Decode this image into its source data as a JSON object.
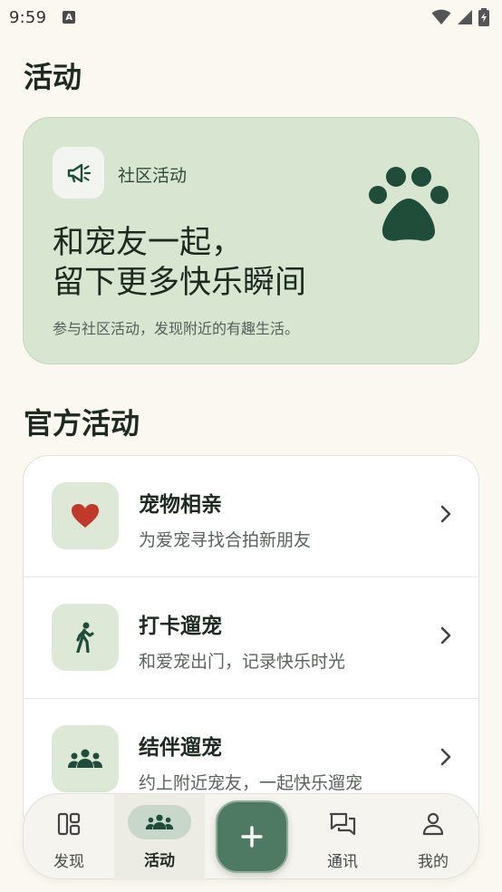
{
  "status_bar": {
    "time": "9:59",
    "a_badge": "A"
  },
  "page": {
    "title": "活动"
  },
  "hero": {
    "tag": "社区活动",
    "headline_line1": "和宠友一起，",
    "headline_line2": "留下更多快乐瞬间",
    "subtitle": "参与社区活动，发现附近的有趣生活。",
    "icon": "megaphone-icon",
    "decoration_icon": "paw-icon"
  },
  "section": {
    "title": "官方活动"
  },
  "activities": [
    {
      "title": "宠物相亲",
      "subtitle": "为爱宠寻找合拍新朋友",
      "icon": "heart-icon"
    },
    {
      "title": "打卡遛宠",
      "subtitle": "和爱宠出门，记录快乐时光",
      "icon": "walking-person-icon"
    },
    {
      "title": "结伴遛宠",
      "subtitle": "约上附近宠友，一起快乐遛宠",
      "icon": "group-icon"
    }
  ],
  "nav": {
    "items": [
      {
        "label": "发现",
        "icon": "dashboard-icon"
      },
      {
        "label": "活动",
        "icon": "group-icon",
        "active": true
      },
      {
        "label": "通讯",
        "icon": "chat-icon"
      },
      {
        "label": "我的",
        "icon": "person-icon"
      }
    ],
    "fab_icon": "plus-icon"
  },
  "colors": {
    "background": "#fbf8f1",
    "primary": "#1f4d3a",
    "hero_bg": "#d7e5d1",
    "heart": "#c0392b",
    "fab": "#4e7a63"
  }
}
